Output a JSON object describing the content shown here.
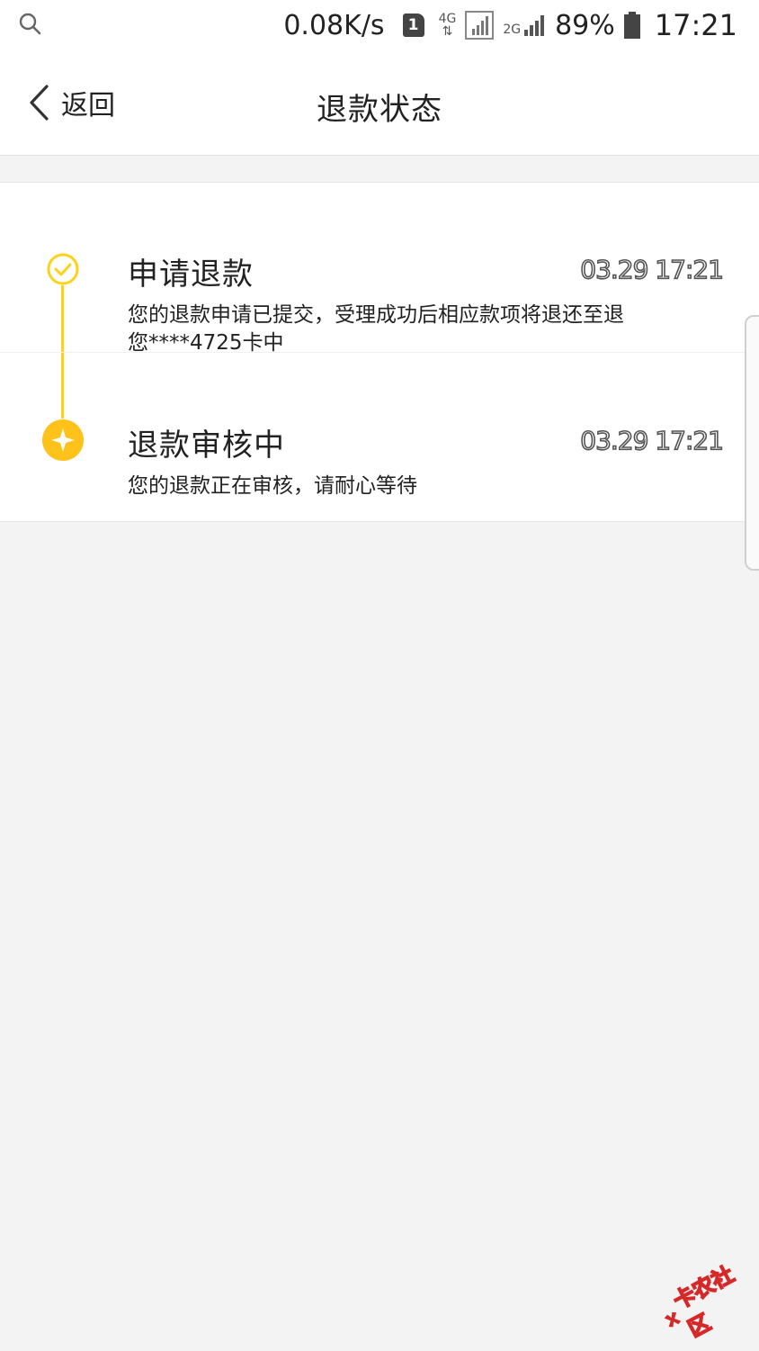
{
  "status_bar": {
    "search_icon": "search-icon",
    "net_speed": "0.08K/s",
    "sim_slot": "1",
    "network_type_1": "4G",
    "network_type_2": "2G",
    "battery_percent": "89%",
    "time": "17:21"
  },
  "header": {
    "back_label": "返回",
    "title": "退款状态"
  },
  "timeline": {
    "accent_color": "#ffd21a",
    "steps": [
      {
        "title": "申请退款",
        "time": "03.29 17:21",
        "description": "您的退款申请已提交，受理成功后相应款项将退还至退您****4725卡中",
        "icon": "check-circle-icon",
        "status": "done"
      },
      {
        "title": "退款审核中",
        "time": "03.29 17:21",
        "description": "您的退款正在审核，请耐心等待",
        "icon": "star-circle-icon",
        "status": "current"
      }
    ]
  },
  "watermark": {
    "text": "卡农社区"
  }
}
